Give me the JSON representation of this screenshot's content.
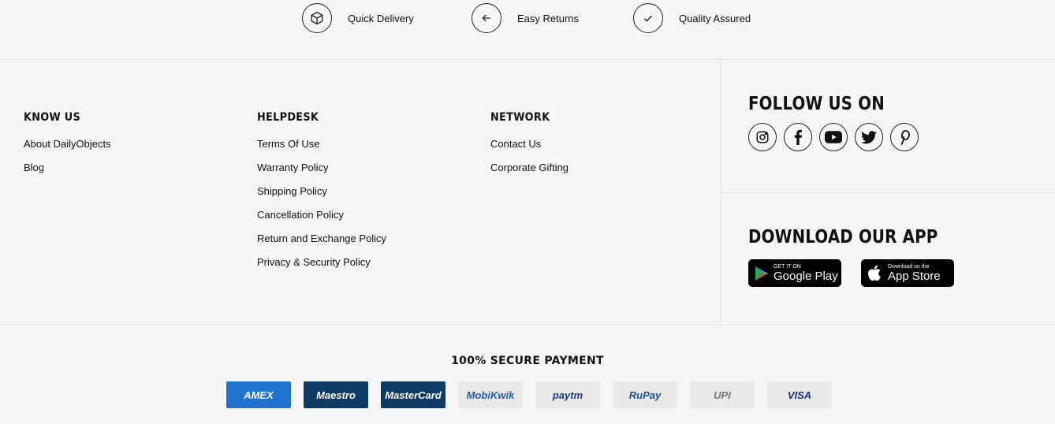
{
  "features": [
    {
      "label": "Quick Delivery",
      "icon": "box-icon"
    },
    {
      "label": "Easy Returns",
      "icon": "arrow-left-icon"
    },
    {
      "label": "Quality Assured",
      "icon": "check-icon"
    }
  ],
  "footer": {
    "know_us": {
      "title": "KNOW US",
      "links": [
        "About DailyObjects",
        "Blog"
      ]
    },
    "helpdesk": {
      "title": "HELPDESK",
      "links": [
        "Terms Of Use",
        "Warranty Policy",
        "Shipping Policy",
        "Cancellation Policy",
        "Return and Exchange Policy",
        "Privacy & Security Policy"
      ]
    },
    "network": {
      "title": "NETWORK",
      "links": [
        "Contact Us",
        "Corporate Gifting"
      ]
    }
  },
  "follow": {
    "title": "FOLLOW US ON",
    "icons": [
      "instagram-icon",
      "facebook-icon",
      "youtube-icon",
      "twitter-icon",
      "pinterest-icon"
    ]
  },
  "app": {
    "title": "DOWNLOAD OUR APP",
    "google": {
      "small": "GET IT ON",
      "big": "Google Play"
    },
    "apple": {
      "small": "Download on the",
      "big": "App Store"
    }
  },
  "payments": {
    "title": "100% SECURE PAYMENT",
    "methods": [
      {
        "label": "AMEX",
        "bg": "#1f72cd",
        "color": "#ffffff"
      },
      {
        "label": "Maestro",
        "bg": "#0e3a66",
        "color": "#ffffff"
      },
      {
        "label": "MasterCard",
        "bg": "#0e3a66",
        "color": "#ffffff"
      },
      {
        "label": "MobiKwik",
        "bg": "#e9e9e9",
        "color": "#1b5ea8"
      },
      {
        "label": "paytm",
        "bg": "#e9e9e9",
        "color": "#1a3a7a"
      },
      {
        "label": "RuPay",
        "bg": "#e9e9e9",
        "color": "#1b4e95"
      },
      {
        "label": "UPI",
        "bg": "#e9e9e9",
        "color": "#777777"
      },
      {
        "label": "VISA",
        "bg": "#e9e9e9",
        "color": "#1a2e7a"
      }
    ]
  }
}
